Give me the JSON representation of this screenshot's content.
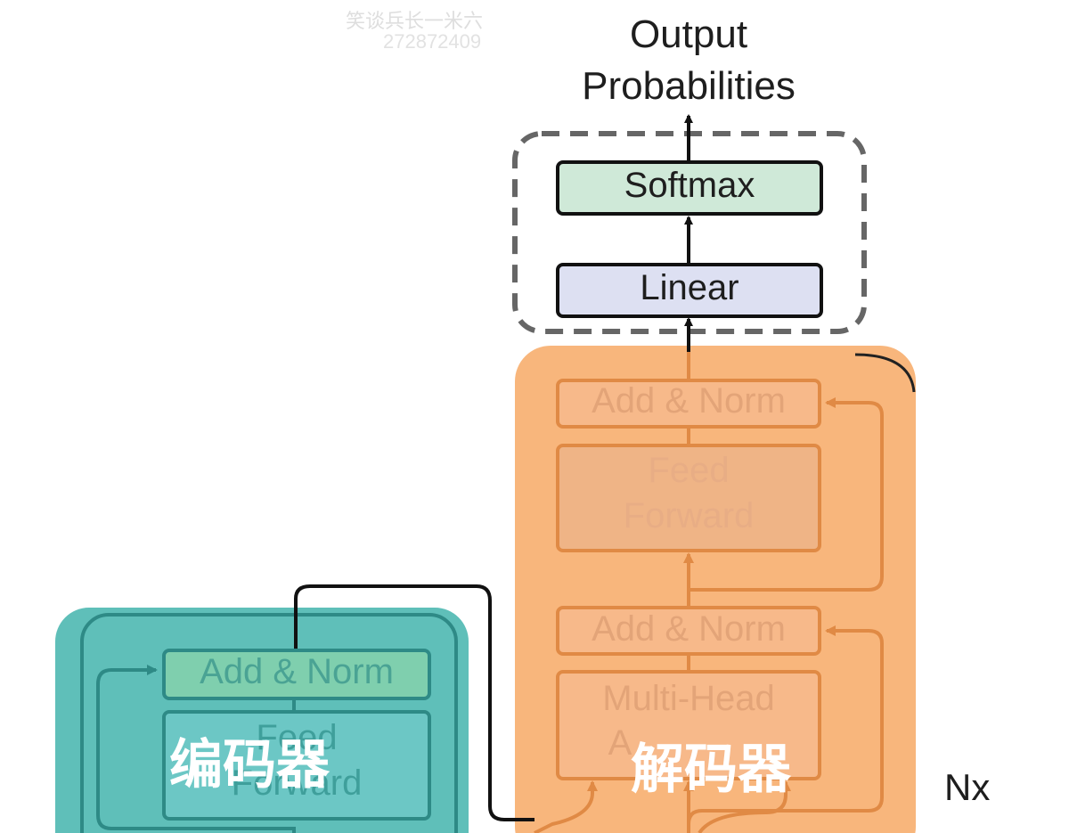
{
  "watermark": {
    "line1": "笑谈兵长一米六",
    "line2": "272872409"
  },
  "output": {
    "line1": "Output",
    "line2": "Probabilities"
  },
  "head": {
    "softmax": "Softmax",
    "linear": "Linear"
  },
  "decoder": {
    "add_norm_top": "Add & Norm",
    "feed_forward_line1": "Feed",
    "feed_forward_line2": "Forward",
    "add_norm_mid": "Add & Norm",
    "multi_head_line1": "Multi-Head",
    "multi_head_line2": "A",
    "overlay_label": "解码器"
  },
  "encoder": {
    "add_norm": "Add & Norm",
    "feed_forward_line1": "Feed",
    "feed_forward_line2": "Forward",
    "overlay_label": "编码器"
  },
  "nx_label": "Nx",
  "colors": {
    "encoder_bg": "#5fbfb9",
    "decoder_bg": "#f8b67c",
    "softmax": "#cfe9d8",
    "linear": "#dde0f2",
    "orange_stroke": "#e08a45",
    "teal_stroke": "#2e8a86"
  }
}
